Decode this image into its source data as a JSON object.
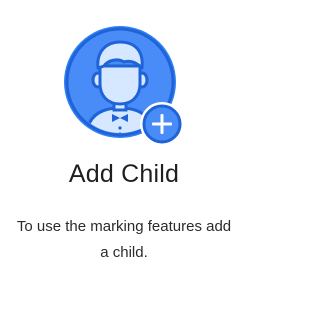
{
  "empty_state": {
    "title": "Add Child",
    "description": "To use the marking features add a child."
  },
  "colors": {
    "accent_blue": "#2f7ff5",
    "circle_fill": "#4a8cf7",
    "light_blue": "#d6e8ff",
    "title_text": "#1f1f1f",
    "body_text": "#2b2b2b"
  },
  "icons": {
    "avatar": "child-avatar-icon",
    "add": "plus-circle-icon"
  }
}
